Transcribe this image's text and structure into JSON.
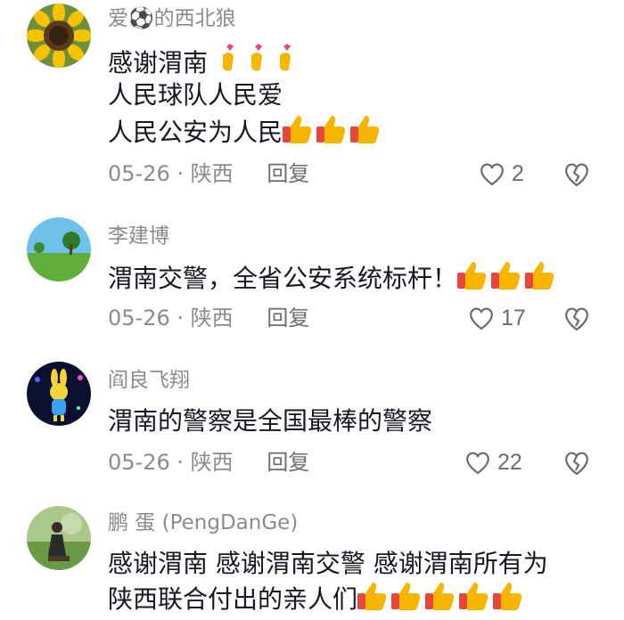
{
  "comments": [
    {
      "username": "爱⚽的西北狼",
      "lines": [
        "感谢渭南",
        "人民球队人民爱",
        "人民公安为人民"
      ],
      "date": "05-26",
      "location": "陕西",
      "reply_label": "回复",
      "likes": "2",
      "avatar_icon": "sunflower-avatar"
    },
    {
      "username": "李建博",
      "lines": [
        "渭南交警，全省公安系统标杆！"
      ],
      "date": "05-26",
      "location": "陕西",
      "reply_label": "回复",
      "likes": "17",
      "avatar_icon": "landscape-avatar"
    },
    {
      "username": "阎良飞翔",
      "lines": [
        "渭南的警察是全国最棒的警察"
      ],
      "date": "05-26",
      "location": "陕西",
      "reply_label": "回复",
      "likes": "22",
      "avatar_icon": "rabbit-avatar"
    },
    {
      "username": "鹏 蛋 (PengDanGe)",
      "lines": [
        "感谢渭南  感谢渭南交警  感谢渭南所有为",
        "陕西联合付出的亲人们"
      ],
      "avatar_icon": "person-outdoor-avatar"
    }
  ],
  "separator": "·",
  "colors": {
    "text": "#161823",
    "muted": "#8a8b91",
    "thumb": "#f7b500",
    "thumb_cuff": "#e8453c",
    "heart_emoji": "#ff3d7f"
  },
  "icons": [
    "like-heart-icon",
    "dislike-broken-heart-icon",
    "thumbs-up-emoji",
    "finger-heart-emoji"
  ]
}
